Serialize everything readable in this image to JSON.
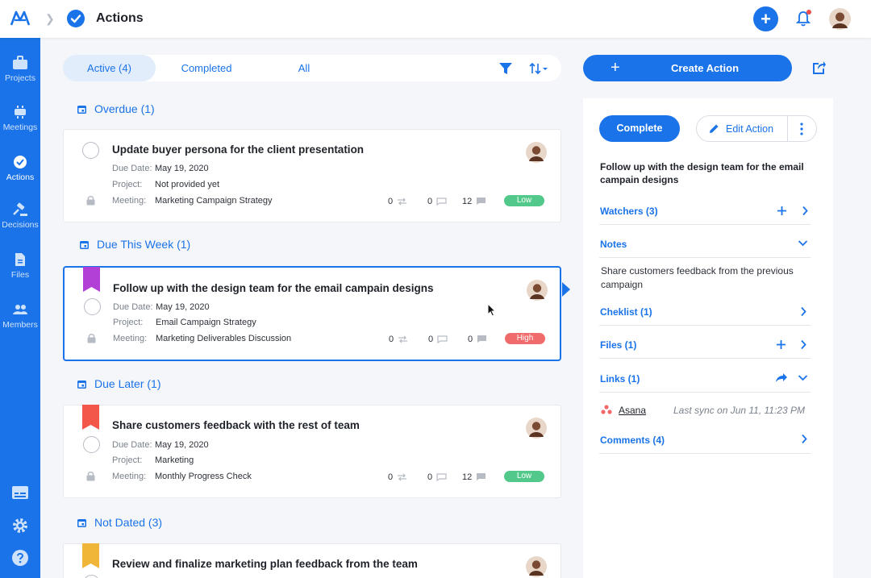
{
  "topbar": {
    "title": "Actions",
    "logo_icon": "app-logo-icon",
    "add_icon": "plus-icon",
    "add_label": "+",
    "notification_icon": "bell-icon",
    "avatar_icon": "user-avatar"
  },
  "sidebar": {
    "items": [
      {
        "label": "Projects",
        "icon": "briefcase-icon"
      },
      {
        "label": "Meetings",
        "icon": "meeting-table-icon"
      },
      {
        "label": "Actions",
        "icon": "check-circle-icon"
      },
      {
        "label": "Decisions",
        "icon": "gavel-icon"
      },
      {
        "label": "Files",
        "icon": "file-icon"
      },
      {
        "label": "Members",
        "icon": "people-icon"
      }
    ],
    "bottom_icons": [
      "board-icon",
      "gear-icon",
      "help-icon"
    ]
  },
  "tabs": {
    "items": [
      "Active (4)",
      "Completed",
      "All"
    ],
    "active_index": 0,
    "filter_icon": "filter-icon",
    "sort_icon": "sort-icon"
  },
  "groups": {
    "overdue": "Overdue (1)",
    "due_this_week": "Due This Week (1)",
    "due_later": "Due Later (1)",
    "not_dated": "Not Dated (3)"
  },
  "labels": {
    "due_date": "Due Date:",
    "project": "Project:",
    "meeting": "Meeting:"
  },
  "cards": [
    {
      "title": "Update buyer persona for the client presentation",
      "due_date": "May 19, 2020",
      "project": "Not provided yet",
      "meeting": "Marketing Campaign Strategy",
      "links": "0",
      "messages": "0",
      "comments": "12",
      "priority": "Low",
      "flag_color": ""
    },
    {
      "title": "Follow up with the design team for the email campain designs",
      "due_date": "May 19, 2020",
      "project": "Email Campaign Strategy",
      "meeting": "Marketing Deliverables Discussion",
      "links": "0",
      "messages": "0",
      "comments": "0",
      "priority": "High",
      "flag_color": "#b23fd6"
    },
    {
      "title": "Share customers feedback with the rest of team",
      "due_date": "May 19, 2020",
      "project": "Marketing",
      "meeting": "Monthly Progress Check",
      "links": "0",
      "messages": "0",
      "comments": "12",
      "priority": "Low",
      "flag_color": "#f2574a"
    },
    {
      "title": "Review and finalize marketing plan feedback from the team",
      "flag_color": "#f0b63a"
    }
  ],
  "colors": {
    "accent": "#1a73e8",
    "priority_low": "#52c98a",
    "priority_high": "#f06b6b"
  },
  "detail": {
    "create_label": "Create Action",
    "create_plus": "+",
    "share_icon": "share-icon",
    "complete_label": "Complete",
    "edit_label": "Edit Action",
    "title": "Follow up with the design team for the email campain designs",
    "watchers_label": "Watchers (3)",
    "notes_label": "Notes",
    "notes_text": "Share customers feedback from the previous campaign",
    "checklist_label": "Cheklist (1)",
    "files_label": "Files (1)",
    "links_label": "Links (1)",
    "asana_label": "Asana",
    "asana_sync": "Last sync on Jun 11, 11:23 PM",
    "comments_label": "Comments (4)"
  }
}
